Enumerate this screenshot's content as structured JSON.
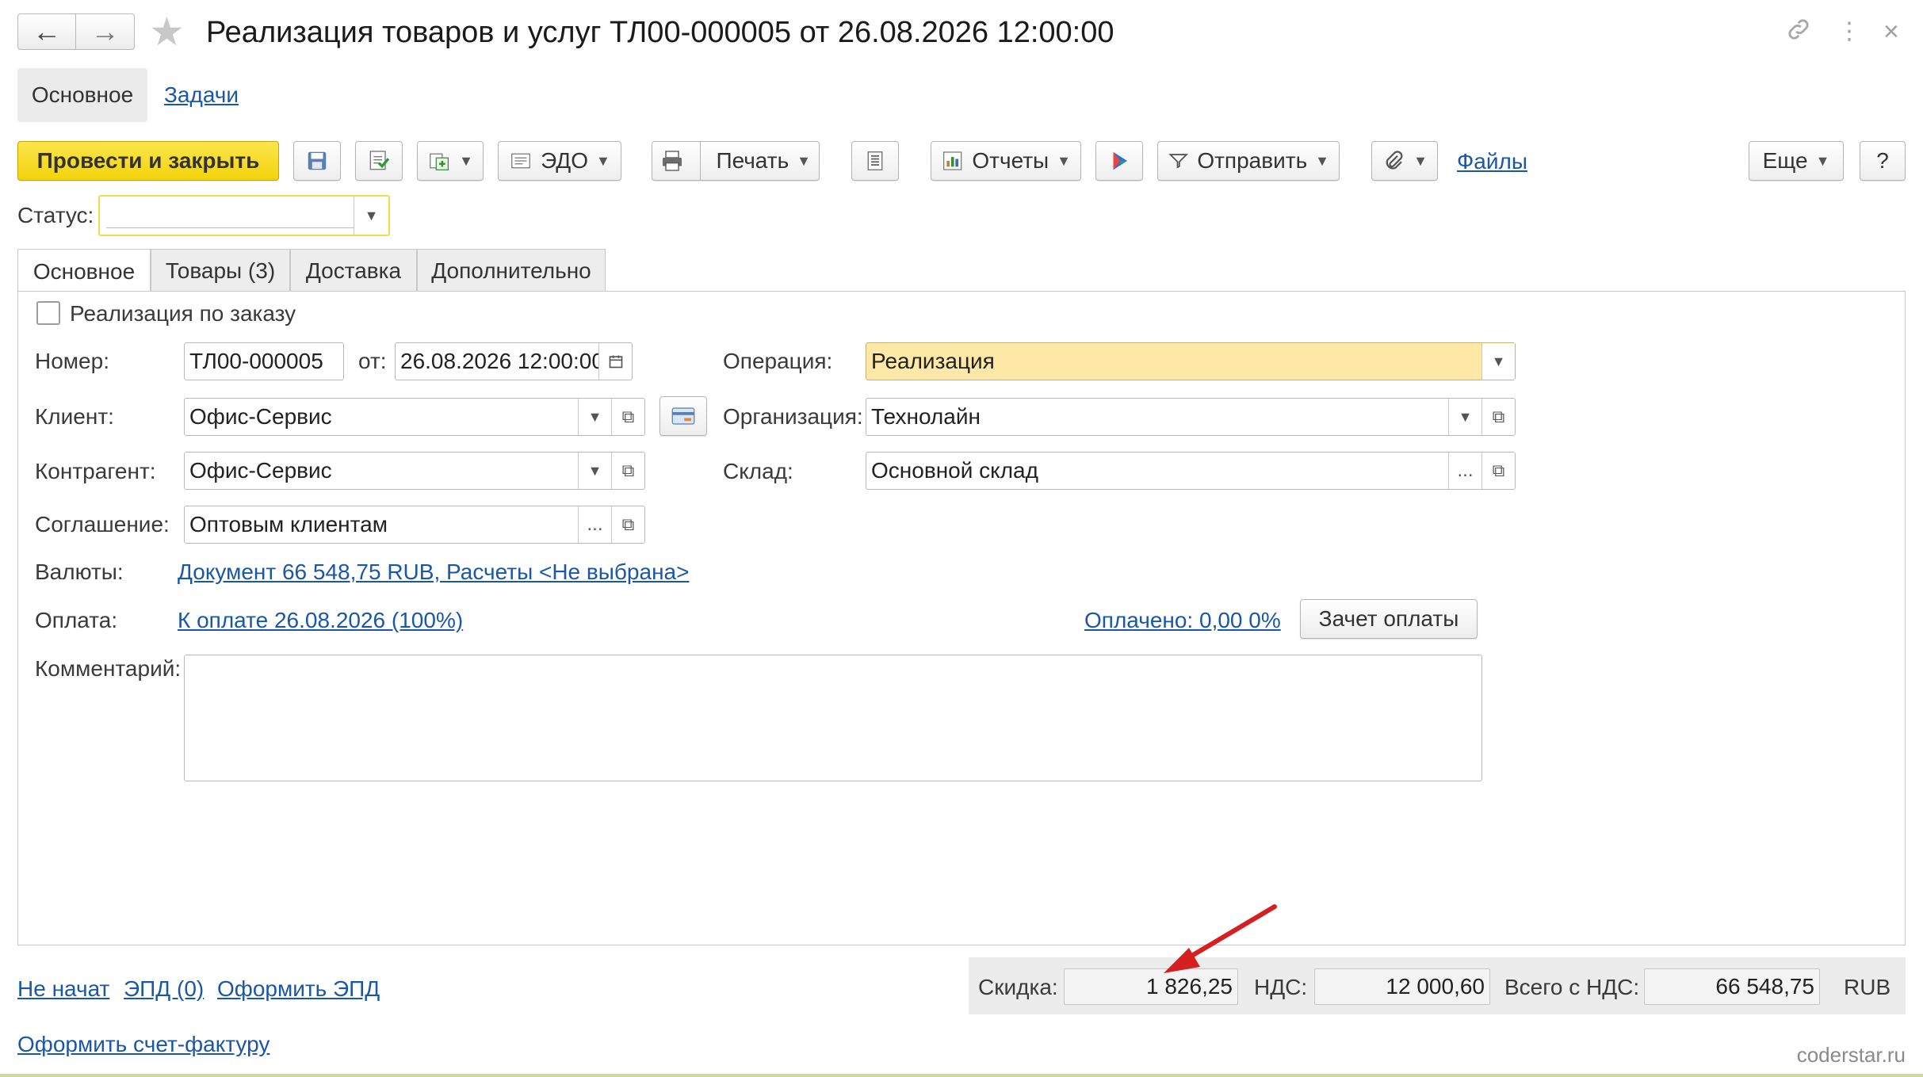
{
  "window": {
    "title": "Реализация товаров и услуг ТЛ00-000005 от 26.08.2026 12:00:00",
    "back_icon": "←",
    "forward_icon": "→",
    "star_icon": "★",
    "link_icon": "🔗",
    "menu_icon": "⋮",
    "close_icon": "×"
  },
  "sections": {
    "main": "Основное",
    "tasks": "Задачи"
  },
  "toolbar": {
    "post_close": "Провести и закрыть",
    "edo": "ЭДО",
    "print": "Печать",
    "reports": "Отчеты",
    "send": "Отправить",
    "files": "Файлы",
    "more": "Еще",
    "help": "?"
  },
  "status": {
    "label": "Статус:",
    "value": ""
  },
  "tabs": [
    {
      "label": "Основное"
    },
    {
      "label": "Товары (3)"
    },
    {
      "label": "Доставка"
    },
    {
      "label": "Дополнительно"
    }
  ],
  "form": {
    "by_order_label": "Реализация по заказу",
    "number_label": "Номер:",
    "number_value": "ТЛ00-000005",
    "from_label": "от:",
    "date_value": "26.08.2026 12:00:00",
    "operation_label": "Операция:",
    "operation_value": "Реализация",
    "client_label": "Клиент:",
    "client_value": "Офис-Сервис",
    "org_label": "Организация:",
    "org_value": "Технолайн",
    "contractor_label": "Контрагент:",
    "contractor_value": "Офис-Сервис",
    "warehouse_label": "Склад:",
    "warehouse_value": "Основной склад",
    "agreement_label": "Соглашение:",
    "agreement_value": "Оптовым клиентам",
    "currency_label": "Валюты:",
    "currency_link": "Документ 66 548,75 RUB, Расчеты <Не выбрана>",
    "payment_label": "Оплата:",
    "payment_link": "К оплате 26.08.2026 (100%)",
    "paid_link": "Оплачено: 0,00  0%",
    "offset_button": "Зачет оплаты",
    "comment_label": "Комментарий:",
    "comment_value": ""
  },
  "footer": {
    "not_started": "Не начат",
    "epd": "ЭПД (0)",
    "make_epd": "Оформить ЭПД",
    "make_invoice": "Оформить счет-фактуру"
  },
  "totals": {
    "discount_label": "Скидка:",
    "discount_value": "1 826,25",
    "vat_label": "НДС:",
    "vat_value": "12 000,60",
    "total_label": "Всего с НДС:",
    "total_value": "66 548,75",
    "currency": "RUB"
  },
  "watermark": "coderstar.ru",
  "colors": {
    "accent_yellow": "#f5d518",
    "link_blue": "#1a57a8",
    "highlight": "#fde8a8",
    "arrow_red": "#d42020"
  }
}
